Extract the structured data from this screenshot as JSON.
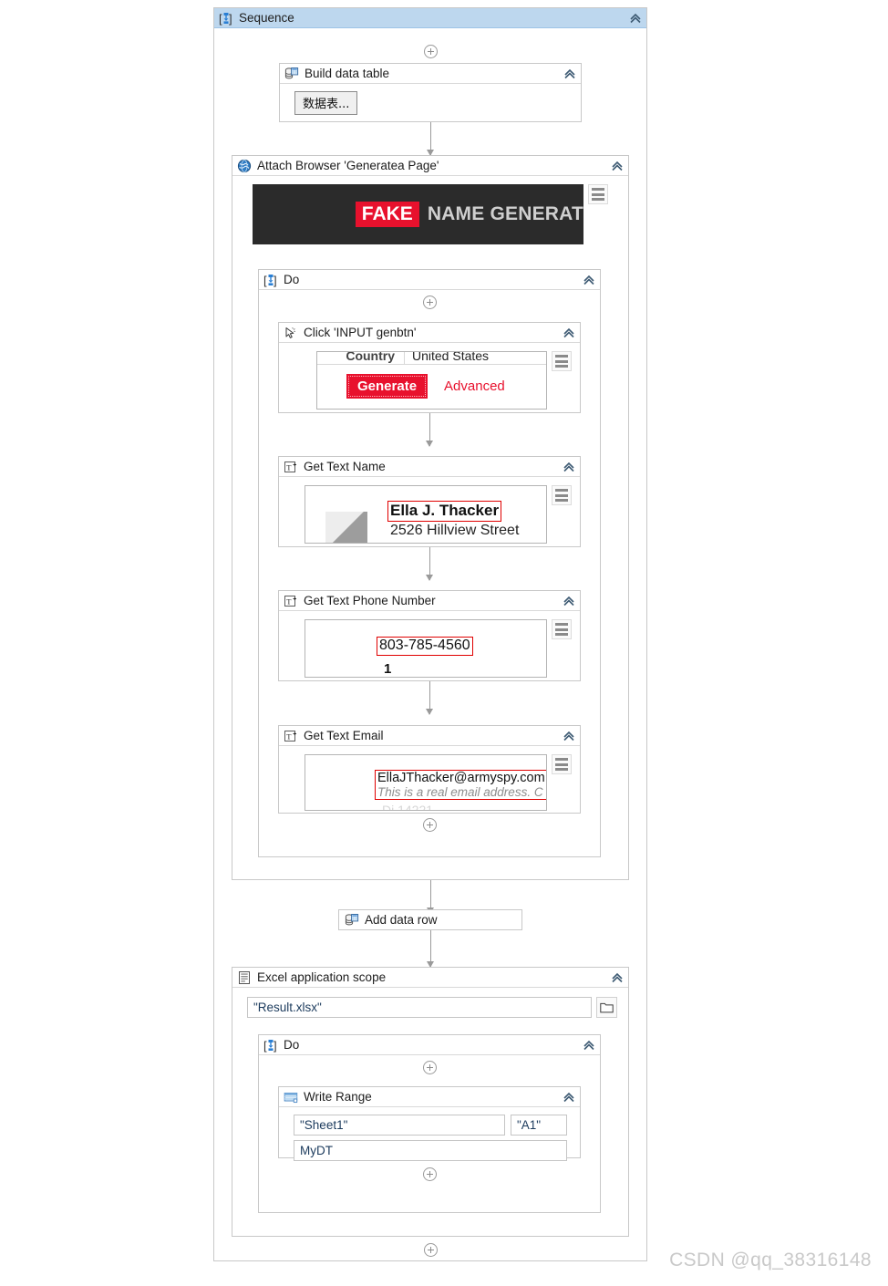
{
  "app": {
    "root_title": "Sequence",
    "watermark": "CSDN @qq_38316148"
  },
  "sequence": {
    "title": "Sequence",
    "icon": "sequence-icon"
  },
  "build_data_table": {
    "title": "Build data table",
    "icon": "data-table-icon",
    "button_label": "数据表..."
  },
  "attach_browser": {
    "title": "Attach Browser 'Generatea Page'",
    "icon": "globe-icon",
    "banner": {
      "badge": "FAKE",
      "text": "NAME GENERAT"
    }
  },
  "do_browser": {
    "title": "Do",
    "icon": "sequence-icon"
  },
  "click_activity": {
    "title": "Click 'INPUT  genbtn'",
    "icon": "click-cursor-icon",
    "preview": {
      "field_label": "Country",
      "field_value": "United States",
      "generate_button": "Generate",
      "advanced_link": "Advanced"
    }
  },
  "get_text_name": {
    "title": "Get Text Name",
    "icon": "get-text-icon",
    "preview": {
      "name": "Ella J. Thacker",
      "address": "2526 Hillview Street"
    }
  },
  "get_text_phone": {
    "title": "Get Text Phone Number",
    "icon": "get-text-icon",
    "preview": {
      "phone": "803-785-4560",
      "sub": "1"
    }
  },
  "get_text_email": {
    "title": "Get Text Email",
    "icon": "get-text-icon",
    "preview": {
      "email": "EllaJThacker@armyspy.com",
      "note": "This is a real email address. C",
      "cut_off": "Di 14221"
    }
  },
  "add_data_row": {
    "title": "Add data row",
    "icon": "data-table-icon"
  },
  "excel_scope": {
    "title": "Excel application scope",
    "icon": "excel-doc-icon",
    "workbook_path": "\"Result.xlsx\"",
    "browse_icon": "folder-icon"
  },
  "do_excel": {
    "title": "Do",
    "icon": "sequence-icon"
  },
  "write_range": {
    "title": "Write Range",
    "icon": "spreadsheet-icon",
    "sheet_name": "\"Sheet1\"",
    "cell_range": "\"A1\"",
    "data_table": "MyDT"
  },
  "icons": {
    "collapse": "chevron-double-up-icon",
    "add": "plus-circle-icon",
    "menu": "hamburger-menu-icon"
  },
  "colors": {
    "header_blue": "#bdd7ee",
    "accent_red": "#e8112d",
    "highlight_red": "#e00000",
    "border_gray": "#c8c8c8",
    "banner_dark": "#2b2b2b"
  }
}
